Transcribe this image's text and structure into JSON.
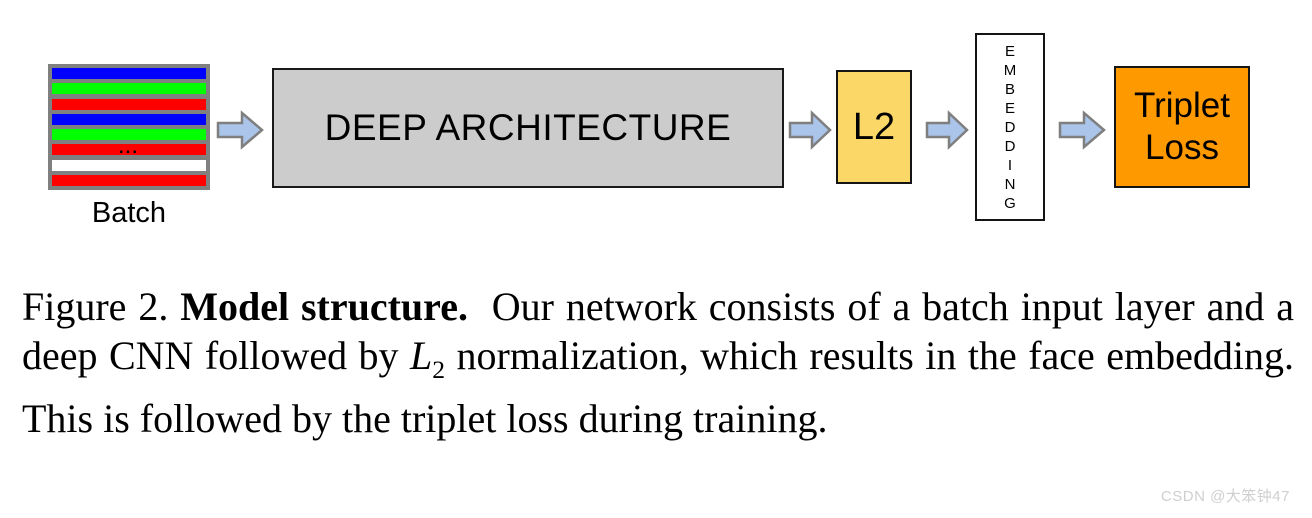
{
  "figure": {
    "diagram": {
      "batch": {
        "label": "Batch",
        "dots": "...",
        "stripes": [
          {
            "name": "stripe-blue-1",
            "color": "#0000ff"
          },
          {
            "name": "stripe-green-1",
            "color": "#00ff00"
          },
          {
            "name": "stripe-red-1",
            "color": "#ff0000"
          },
          {
            "name": "stripe-blue-2",
            "color": "#0000ff"
          },
          {
            "name": "stripe-green-2",
            "color": "#00ff00"
          },
          {
            "name": "stripe-red-2",
            "color": "#ff0000"
          },
          {
            "name": "stripe-white-1",
            "color": "#ffffff"
          },
          {
            "name": "stripe-red-3",
            "color": "#ff0000"
          }
        ],
        "background_color": "#808080"
      },
      "deep_architecture": {
        "label": "DEEP ARCHITECTURE",
        "fill_color": "#cccccc",
        "border_color": "#1a1a1a"
      },
      "l2": {
        "label": "L2",
        "fill_color": "#fad766",
        "border_color": "#141414"
      },
      "embedding": {
        "label": "EMBEDDING",
        "letters": [
          "E",
          "M",
          "B",
          "E",
          "D",
          "D",
          "I",
          "N",
          "G"
        ],
        "fill_color": "#ffffff",
        "border_color": "#141414"
      },
      "triplet_loss": {
        "line1": "Triplet",
        "line2": "Loss",
        "fill_color": "#ff9900",
        "border_color": "#141414"
      },
      "arrows": {
        "fill_color": "#aac4ea",
        "border_color": "#7f7f7f",
        "items": [
          {
            "name": "arrow-batch-to-deep"
          },
          {
            "name": "arrow-deep-to-l2"
          },
          {
            "name": "arrow-l2-to-embedding"
          },
          {
            "name": "arrow-embedding-to-triplet"
          }
        ]
      }
    },
    "caption": {
      "prefix": "Figure 2.",
      "bold_title": "Model structure.",
      "text_part1": "Our network consists of a batch input layer and a deep CNN followed by",
      "math_var": "L",
      "math_sub": "2",
      "text_part2": "normalization, which results in the face embedding. This is followed by the triplet loss during training."
    },
    "watermark": "CSDN @大笨钟47"
  }
}
